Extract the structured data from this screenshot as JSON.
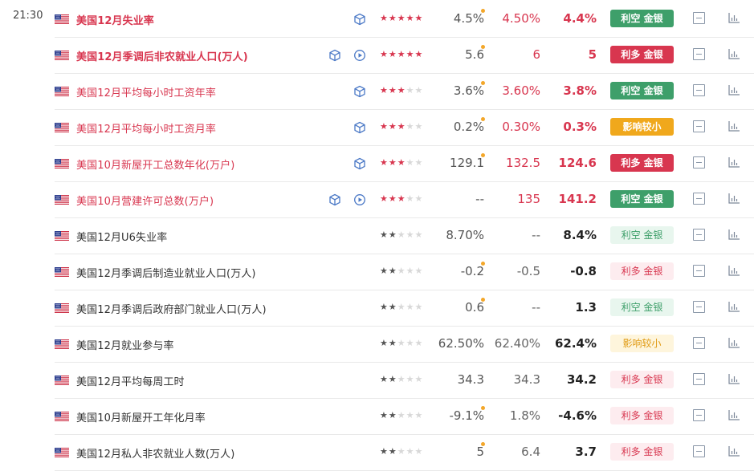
{
  "time": "21:30",
  "columns": [
    "country",
    "indicator",
    "importance",
    "previous",
    "forecast",
    "actual",
    "impact"
  ],
  "colors": {
    "accent_red": "#d8364f",
    "accent_green": "#3e9f6a",
    "accent_yellow": "#f0a81c",
    "dot_orange": "#f3a72a",
    "divider": "#e9e9e9"
  },
  "rows": [
    {
      "country": "US",
      "name": "美国12月失业率",
      "stars": 5,
      "previous": "4.5%",
      "forecast": "4.50%",
      "actual": "4.4%",
      "impact": "利空 金银",
      "impact_type": "kong",
      "level": "hi",
      "strong": true,
      "icons": [
        "cube-icon"
      ],
      "revised": true
    },
    {
      "country": "US",
      "name": "美国12月季调后非农就业人口(万人)",
      "stars": 5,
      "previous": "5.6",
      "forecast": "6",
      "actual": "5",
      "impact": "利多 金银",
      "impact_type": "duo",
      "level": "hi",
      "strong": true,
      "icons": [
        "cube-icon",
        "play-icon"
      ],
      "revised": true
    },
    {
      "country": "US",
      "name": "美国12月平均每小时工资年率",
      "stars": 3,
      "previous": "3.6%",
      "forecast": "3.60%",
      "actual": "3.8%",
      "impact": "利空 金银",
      "impact_type": "kong",
      "level": "hi",
      "strong": false,
      "icons": [
        "cube-icon"
      ],
      "revised": true
    },
    {
      "country": "US",
      "name": "美国12月平均每小时工资月率",
      "stars": 3,
      "previous": "0.2%",
      "forecast": "0.30%",
      "actual": "0.3%",
      "impact": "影响较小",
      "impact_type": "xiao",
      "level": "hi",
      "strong": false,
      "icons": [
        "cube-icon"
      ],
      "revised": true
    },
    {
      "country": "US",
      "name": "美国10月新屋开工总数年化(万户)",
      "stars": 3,
      "previous": "129.1",
      "forecast": "132.5",
      "actual": "124.6",
      "impact": "利多 金银",
      "impact_type": "duo",
      "level": "hi",
      "strong": false,
      "icons": [
        "cube-icon"
      ],
      "revised": true
    },
    {
      "country": "US",
      "name": "美国10月营建许可总数(万户)",
      "stars": 3,
      "previous": "--",
      "forecast": "135",
      "actual": "141.2",
      "impact": "利空 金银",
      "impact_type": "kong",
      "level": "hi",
      "strong": false,
      "icons": [
        "cube-icon",
        "play-icon"
      ],
      "revised": false
    },
    {
      "country": "US",
      "name": "美国12月U6失业率",
      "stars": 2,
      "previous": "8.70%",
      "forecast": "--",
      "actual": "8.4%",
      "impact": "利空 金银",
      "impact_type": "kong",
      "level": "lo",
      "strong": false,
      "icons": [],
      "revised": false
    },
    {
      "country": "US",
      "name": "美国12月季调后制造业就业人口(万人)",
      "stars": 2,
      "previous": "-0.2",
      "forecast": "-0.5",
      "actual": "-0.8",
      "impact": "利多 金银",
      "impact_type": "duo",
      "level": "lo",
      "strong": false,
      "icons": [],
      "revised": true
    },
    {
      "country": "US",
      "name": "美国12月季调后政府部门就业人口(万人)",
      "stars": 2,
      "previous": "0.6",
      "forecast": "--",
      "actual": "1.3",
      "impact": "利空 金银",
      "impact_type": "kong",
      "level": "lo",
      "strong": false,
      "icons": [],
      "revised": true
    },
    {
      "country": "US",
      "name": "美国12月就业参与率",
      "stars": 2,
      "previous": "62.50%",
      "forecast": "62.40%",
      "actual": "62.4%",
      "impact": "影响较小",
      "impact_type": "xiao",
      "level": "lo",
      "strong": false,
      "icons": [],
      "revised": false
    },
    {
      "country": "US",
      "name": "美国12月平均每周工时",
      "stars": 2,
      "previous": "34.3",
      "forecast": "34.3",
      "actual": "34.2",
      "impact": "利多 金银",
      "impact_type": "duo",
      "level": "lo",
      "strong": false,
      "icons": [],
      "revised": false
    },
    {
      "country": "US",
      "name": "美国10月新屋开工年化月率",
      "stars": 2,
      "previous": "-9.1%",
      "forecast": "1.8%",
      "actual": "-4.6%",
      "impact": "利多 金银",
      "impact_type": "duo",
      "level": "lo",
      "strong": false,
      "icons": [],
      "revised": true
    },
    {
      "country": "US",
      "name": "美国12月私人非农就业人数(万人)",
      "stars": 2,
      "previous": "5",
      "forecast": "6.4",
      "actual": "3.7",
      "impact": "利多 金银",
      "impact_type": "duo",
      "level": "lo",
      "strong": false,
      "icons": [],
      "revised": true
    }
  ]
}
